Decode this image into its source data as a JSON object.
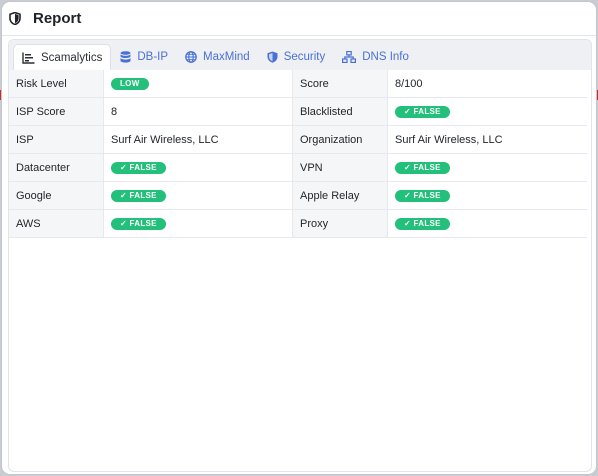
{
  "window": {
    "title": "Report"
  },
  "tabs": [
    {
      "label": "Scamalytics",
      "icon": "chart-icon",
      "active": true
    },
    {
      "label": "DB-IP",
      "icon": "database-icon"
    },
    {
      "label": "MaxMind",
      "icon": "globe-icon"
    },
    {
      "label": "Security",
      "icon": "shield-icon"
    },
    {
      "label": "DNS Info",
      "icon": "network-icon"
    }
  ],
  "rows": [
    {
      "l1": "Risk Level",
      "v1": "LOW",
      "l2": "Score",
      "v2": "8/100"
    },
    {
      "l1": "ISP Score",
      "v1": "8",
      "l2": "Blacklisted",
      "v2": "✓ FALSE"
    },
    {
      "l1": "ISP",
      "v1": "Surf Air Wireless, LLC",
      "l2": "Organization",
      "v2": "Surf Air Wireless, LLC"
    },
    {
      "l1": "Datacenter",
      "v1": "✓ FALSE",
      "l2": "VPN",
      "v2": "✓ FALSE"
    },
    {
      "l1": "Google",
      "v1": "✓ FALSE",
      "l2": "Apple Relay",
      "v2": "✓ FALSE"
    },
    {
      "l1": "AWS",
      "v1": "✓ FALSE",
      "l2": "Proxy",
      "v2": "✓ FALSE"
    }
  ],
  "colors": {
    "badge": "#22c07a",
    "tab_link": "#4a70d6",
    "accent_edge": "#d9261c"
  }
}
